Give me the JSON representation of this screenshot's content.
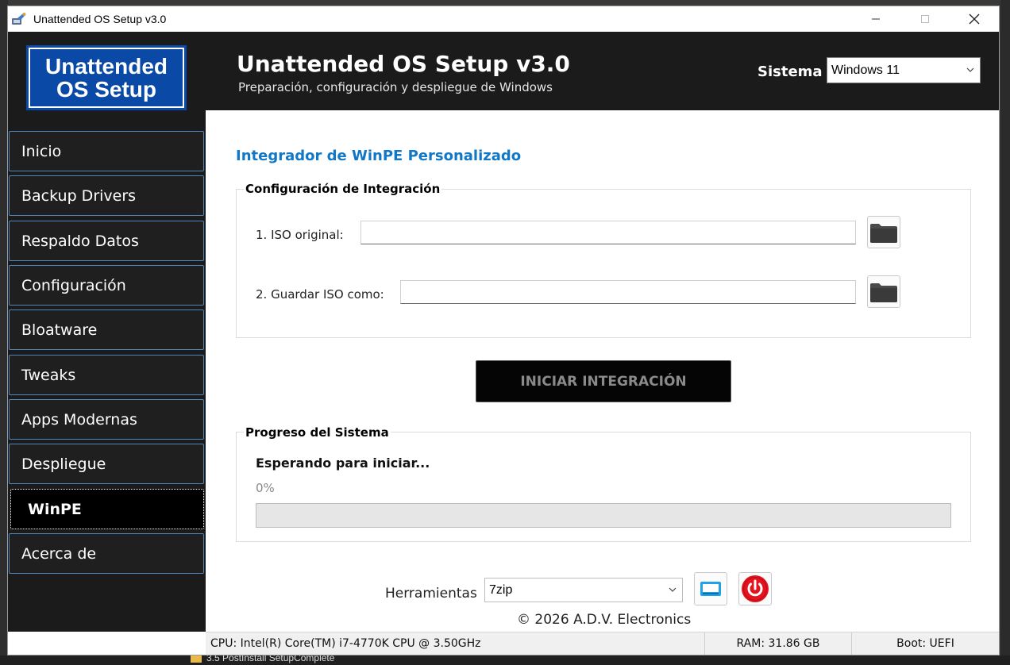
{
  "window": {
    "title": "Unattended OS Setup v3.0"
  },
  "header": {
    "logo_line1": "Unattended",
    "logo_line2": "OS Setup",
    "title": "Unattended OS Setup v3.0",
    "subtitle": "Preparación, configuración y despliegue de Windows",
    "system_label": "Sistema",
    "system_value": "Windows 11"
  },
  "sidebar": {
    "items": [
      {
        "label": "Inicio",
        "active": false
      },
      {
        "label": "Backup Drivers",
        "active": false
      },
      {
        "label": "Respaldo Datos",
        "active": false
      },
      {
        "label": "Configuración",
        "active": false
      },
      {
        "label": "Bloatware",
        "active": false
      },
      {
        "label": "Tweaks",
        "active": false
      },
      {
        "label": "Apps Modernas",
        "active": false
      },
      {
        "label": "Despliegue",
        "active": false
      },
      {
        "label": "WinPE",
        "active": true
      },
      {
        "label": "Acerca de",
        "active": false
      }
    ]
  },
  "main": {
    "section_title": "Integrador de WinPE Personalizado",
    "config_group": {
      "label": "Configuración de Integración",
      "iso_original_label": "1. ISO original:",
      "iso_original_value": "",
      "save_iso_label": "2. Guardar ISO como:",
      "save_iso_value": ""
    },
    "start_button": "INICIAR INTEGRACIÓN",
    "progress_group": {
      "label": "Progreso del Sistema",
      "status": "Esperando para iniciar...",
      "percent_text": "0%",
      "progress": 0
    },
    "tools": {
      "label": "Herramientas",
      "selected": "7zip"
    },
    "copyright": "© 2026 A.D.V. Electronics"
  },
  "statusbar": {
    "cpu": "CPU: Intel(R) Core(TM) i7-4770K CPU @ 3.50GHz",
    "ram": "RAM: 31.86 GB",
    "boot": "Boot: UEFI"
  },
  "background": {
    "taskbar_item": "3.5 PostInstall SetupComplete"
  },
  "colors": {
    "accent_blue": "#1178c8",
    "logo_blue": "#0a4aa6",
    "header_bg": "#1b1b1b",
    "nav_border": "#4f86bd",
    "power_red": "#e3141f"
  }
}
